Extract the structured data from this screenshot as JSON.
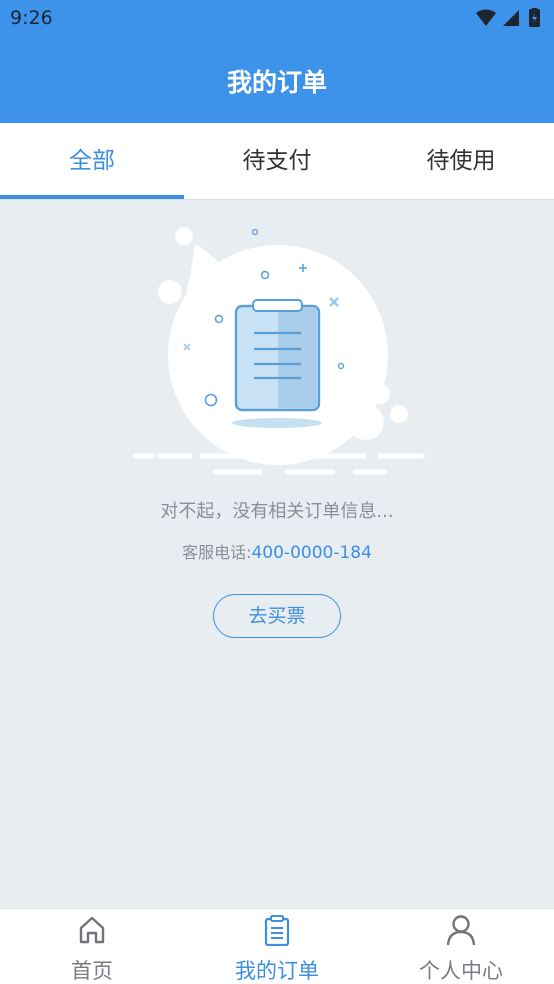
{
  "status_bar": {
    "time": "9:26"
  },
  "app_bar": {
    "title": "我的订单"
  },
  "tabs": [
    {
      "label": "全部",
      "active": true
    },
    {
      "label": "待支付",
      "active": false
    },
    {
      "label": "待使用",
      "active": false
    }
  ],
  "empty_state": {
    "message": "对不起，没有相关订单信息...",
    "hotline_label": "客服电话:",
    "hotline_number": "400-0000-184",
    "button_label": "去买票"
  },
  "bottom_nav": [
    {
      "label": "首页",
      "icon": "home-icon",
      "active": false
    },
    {
      "label": "我的订单",
      "icon": "order-list-icon",
      "active": true
    },
    {
      "label": "个人中心",
      "icon": "person-icon",
      "active": false
    }
  ],
  "colors": {
    "primary": "#3d92ea",
    "accent": "#3d8fe0",
    "background": "#e8edf2",
    "muted_text": "#8a8f96"
  }
}
